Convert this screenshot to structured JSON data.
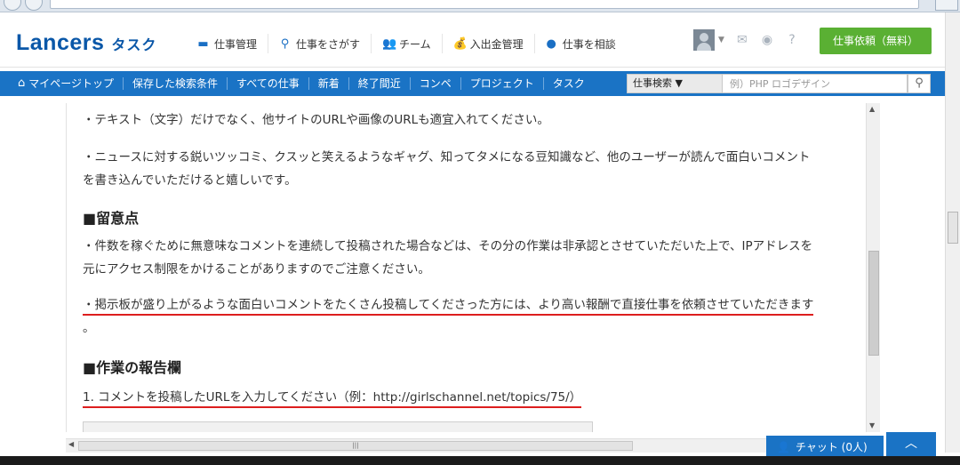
{
  "header": {
    "logo_main": "Lancers",
    "logo_sub": "タスク",
    "nav": [
      {
        "label": "仕事管理",
        "icon": "folder-icon"
      },
      {
        "label": "仕事をさがす",
        "icon": "search-icon"
      },
      {
        "label": "チーム",
        "icon": "team-icon"
      },
      {
        "label": "入出金管理",
        "icon": "money-bag-icon"
      },
      {
        "label": "仕事を相談",
        "icon": "chat-bubble-icon"
      }
    ],
    "cta_label": "仕事依頼（無料）"
  },
  "bluenav": {
    "items": [
      "マイページトップ",
      "保存した検索条件",
      "すべての仕事",
      "新着",
      "終了間近",
      "コンペ",
      "プロジェクト",
      "タスク"
    ],
    "search_select": "仕事検索 ▼",
    "search_placeholder": "例）PHP ロゴデザイン"
  },
  "content": {
    "p1": "・テキスト（文字）だけでなく、他サイトのURLや画像のURLも適宜入れてください。",
    "p2a": "・ニュースに対する鋭いツッコミ、クスッと笑えるようなギャグ、知ってタメになる豆知識など、他のユーザーが読んで面白いコメント",
    "p2b": "を書き込んでいただけると嬉しいです。",
    "heading1": "■留意点",
    "p3a": "・件数を稼ぐために無意味なコメントを連続して投稿された場合などは、その分の作業は非承認とさせていただいた上で、IPアドレスを",
    "p3b": "元にアクセス制限をかけることがありますのでご注意ください。",
    "p4a": "・掲示板が盛り上がるような面白いコメントをたくさん投稿してくださった方には、より高い報酬で直接仕事を依頼させていただきます",
    "p4b": "。",
    "heading2": "■作業の報告欄",
    "q1": "1. コメントを投稿したURLを入力してください（例：http://girlschannel.net/topics/75/）"
  },
  "chat": {
    "label": "チャット (0人)",
    "toggle": "︿"
  }
}
